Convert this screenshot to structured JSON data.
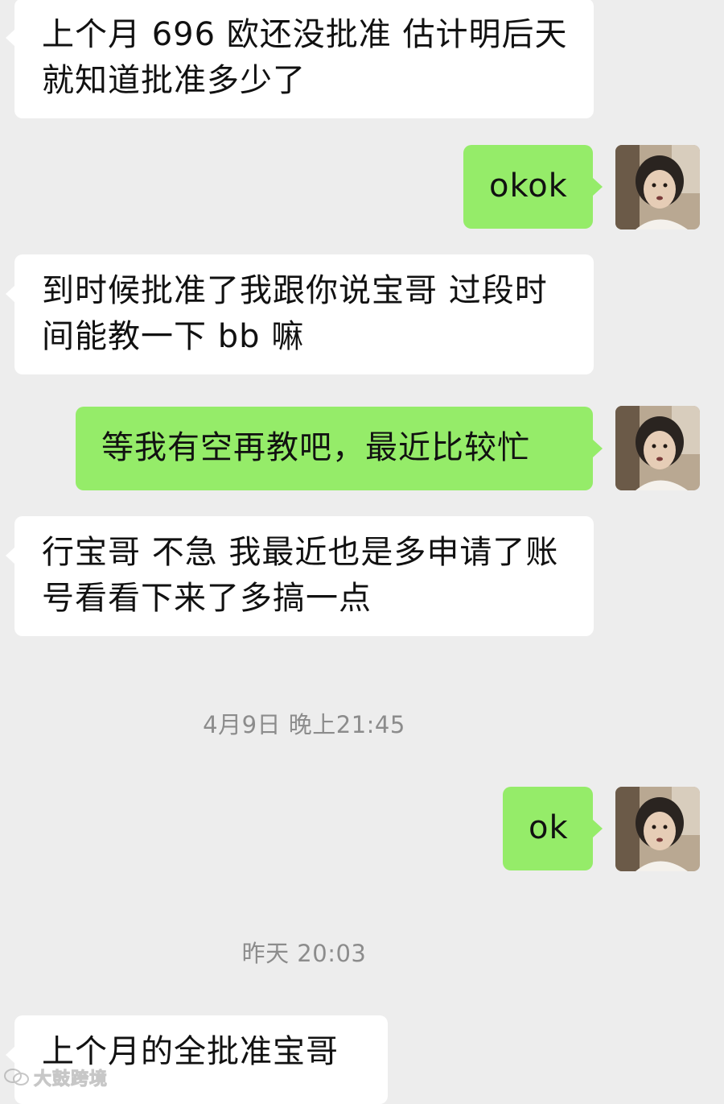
{
  "chat": {
    "messages": [
      {
        "side": "incoming",
        "text": "上个月 696 欧还没批准 估计明后天就知道批准多少了"
      },
      {
        "side": "outgoing",
        "text": "okok",
        "avatar_icon": "child-portrait-avatar"
      },
      {
        "side": "incoming",
        "text": "到时候批准了我跟你说宝哥 过段时间能教一下 bb 嘛"
      },
      {
        "side": "outgoing",
        "text": "等我有空再教吧，最近比较忙",
        "avatar_icon": "child-portrait-avatar"
      },
      {
        "side": "incoming",
        "text": "行宝哥 不急 我最近也是多申请了账号看看下来了多搞一点"
      },
      {
        "side": "timestamp",
        "text": "4月9日 晚上21:45"
      },
      {
        "side": "outgoing",
        "text": "ok",
        "avatar_icon": "child-portrait-avatar"
      },
      {
        "side": "timestamp",
        "text": "昨天 20:03"
      },
      {
        "side": "incoming",
        "text": "上个月的全批准宝哥"
      }
    ]
  },
  "watermark": {
    "text": "大鼓跨境",
    "icon": "wechat-logo-icon"
  },
  "colors": {
    "background": "#ededed",
    "incoming_bubble": "#ffffff",
    "outgoing_bubble": "#95ec69",
    "timestamp_text": "#8c8c8c"
  }
}
